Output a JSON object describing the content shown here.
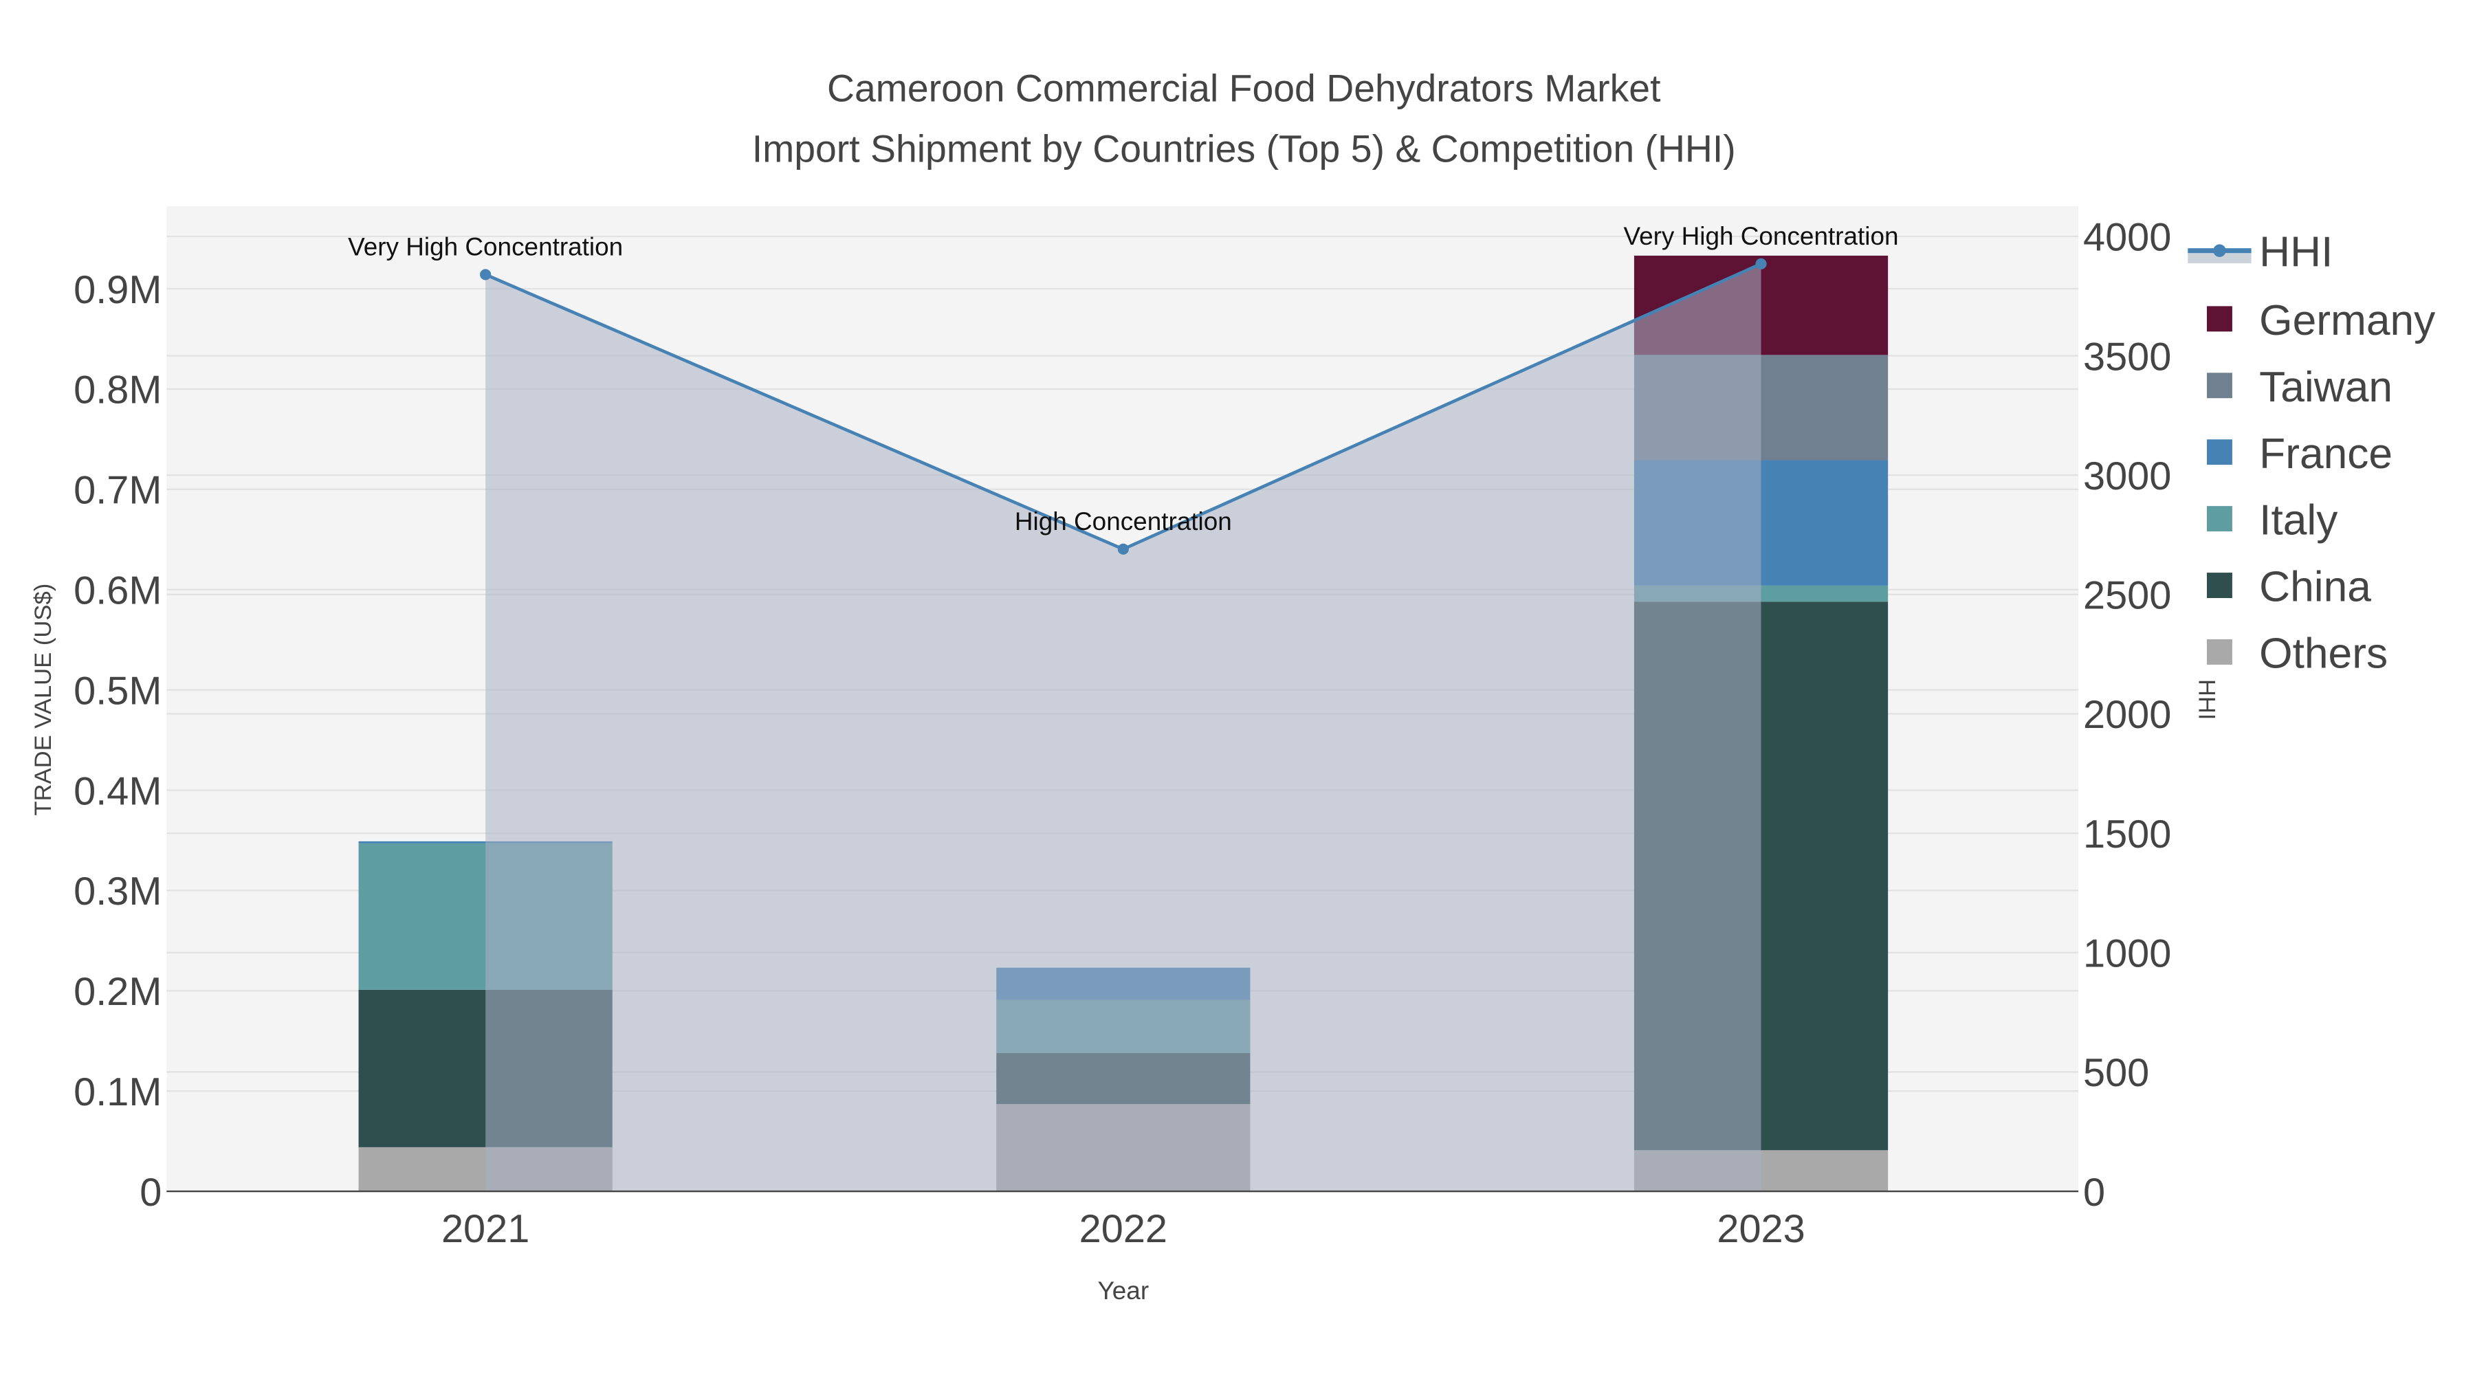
{
  "chart_data": {
    "type": "bar",
    "title_line1": "Cameroon Commercial Food Dehydrators Market",
    "title_line2": "Import Shipment by Countries (Top 5) & Competition (HHI)",
    "xlabel": "Year",
    "ylabel": "TRADE VALUE (US$)",
    "y2label": "HHI",
    "categories": [
      "2021",
      "2022",
      "2023"
    ],
    "ylim": [
      0,
      980000
    ],
    "y2lim": [
      0,
      4130
    ],
    "yticks": [
      0,
      100000,
      200000,
      300000,
      400000,
      500000,
      600000,
      700000,
      800000,
      900000
    ],
    "ytick_labels": [
      "0",
      "0.1M",
      "0.2M",
      "0.3M",
      "0.4M",
      "0.5M",
      "0.6M",
      "0.7M",
      "0.8M",
      "0.9M"
    ],
    "y2ticks": [
      0,
      500,
      1000,
      1500,
      2000,
      2500,
      3000,
      3500,
      4000
    ],
    "y2tick_labels": [
      "0",
      "500",
      "1000",
      "1500",
      "2000",
      "2500",
      "3000",
      "3500",
      "4000"
    ],
    "grid": true,
    "legend_position": "right",
    "series": [
      {
        "name": "Others",
        "color": "#a9a9a9",
        "values": [
          44000,
          87000,
          41000
        ]
      },
      {
        "name": "China",
        "color": "#2f4f4f",
        "values": [
          157000,
          51000,
          547000
        ]
      },
      {
        "name": "Italy",
        "color": "#5f9ea0",
        "values": [
          146000,
          53000,
          16000
        ]
      },
      {
        "name": "France",
        "color": "#4682b4",
        "values": [
          2000,
          32000,
          125000
        ]
      },
      {
        "name": "Taiwan",
        "color": "#708090",
        "values": [
          0,
          0,
          105000
        ]
      },
      {
        "name": "Germany",
        "color": "#5e1234",
        "values": [
          0,
          0,
          99000
        ]
      }
    ],
    "hhi": {
      "name": "HHI",
      "color": "#4682b4",
      "values": [
        3840,
        2690,
        3885
      ],
      "annotations": [
        "Very High Concentration",
        "High Concentration",
        "Very High Concentration"
      ]
    },
    "legend_order": [
      "HHI",
      "Germany",
      "Taiwan",
      "France",
      "Italy",
      "China",
      "Others"
    ]
  }
}
